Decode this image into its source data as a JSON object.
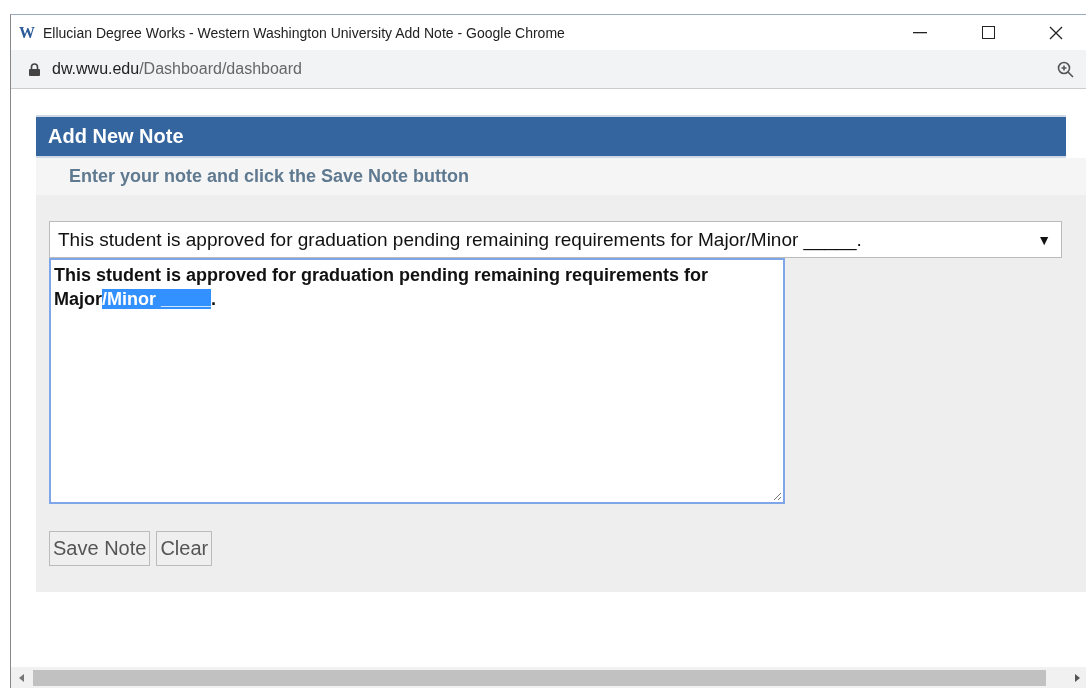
{
  "window": {
    "title": "Ellucian Degree Works - Western Washington University Add Note - Google Chrome",
    "logo": "W"
  },
  "address_bar": {
    "host": "dw.wwu.edu",
    "path": "/Dashboard/dashboard"
  },
  "panel": {
    "title": "Add New Note",
    "subtitle": "Enter your note and click the Save Note button"
  },
  "template_dropdown": {
    "value": "This student is approved for graduation pending remaining requirements for Major/Minor _____.",
    "caret": "▼"
  },
  "note": {
    "text_before": "This student is approved for graduation pending remaining requirements for Major",
    "selected_text": "/Minor _____",
    "text_after": "."
  },
  "buttons": [
    {
      "label": "Save Note"
    },
    {
      "label": "Clear"
    }
  ]
}
